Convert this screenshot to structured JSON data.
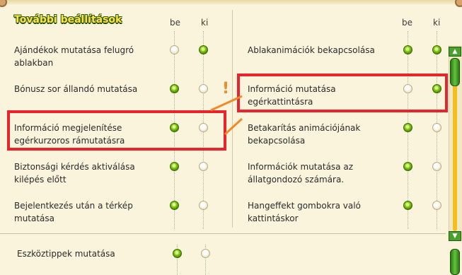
{
  "title": "További beállítások",
  "headers": {
    "on": "be",
    "off": "ki"
  },
  "left_options": [
    {
      "label": "Ajándékok mutatása felugró ablakban",
      "line1": "Ajándékok mutatása felugró",
      "line2": "ablakban",
      "selected": "ki"
    },
    {
      "label": "Bónusz sor állandó mutatása",
      "line1": "Bónusz sor állandó mutatása",
      "line2": "",
      "selected": "be"
    },
    {
      "label": "Információ megjelenítése egérkurzoros rámutatásra",
      "line1": "Információ megjelenítése",
      "line2": "egérkurzoros rámutatásra",
      "selected": "be"
    },
    {
      "label": "Biztonsági kérdés aktiválása kilépés előtt",
      "line1": "Biztonsági kérdés aktiválása",
      "line2": "kilépés előtt",
      "selected": "be"
    },
    {
      "label": "Bejelentkezés után a térkép mutatása",
      "line1": "Bejelentkezés után a térkép",
      "line2": "mutatása",
      "selected": "be"
    }
  ],
  "right_options": [
    {
      "label": "Ablakanimációk bekapcsolása",
      "line1": "Ablakanimációk bekapcsolása",
      "line2": "",
      "selected": "be"
    },
    {
      "label": "Információ mutatása egérkattintásra",
      "line1": "Információ mutatása",
      "line2": "egérkattintásra",
      "selected": "ki"
    },
    {
      "label": "Betakarítás animációjának bekapcsolása",
      "line1": "Betakarítás animációjának",
      "line2": "bekapcsolása",
      "selected": "be"
    },
    {
      "label": "Információk mutatása az állatgondozó számára.",
      "line1": "Információk mutatása az",
      "line2": "állatgondozó számára.",
      "selected": "be"
    },
    {
      "label": "Hangeffekt gombokra való kattintáskor",
      "line1": "Hangeffekt gombokra való",
      "line2": "kattintáskor",
      "selected": "be"
    }
  ],
  "bottom_option": {
    "label": "Eszköztippek mutatása",
    "selected": "be"
  },
  "annotation": "!",
  "icons": {
    "scroll_up": "arrow-up-icon",
    "scroll_down": "arrow-down-icon"
  },
  "colors": {
    "highlight": "#e8232b",
    "arrow": "#f08a28",
    "title": "#ffe24a",
    "radio_on": "#8fd21a"
  }
}
